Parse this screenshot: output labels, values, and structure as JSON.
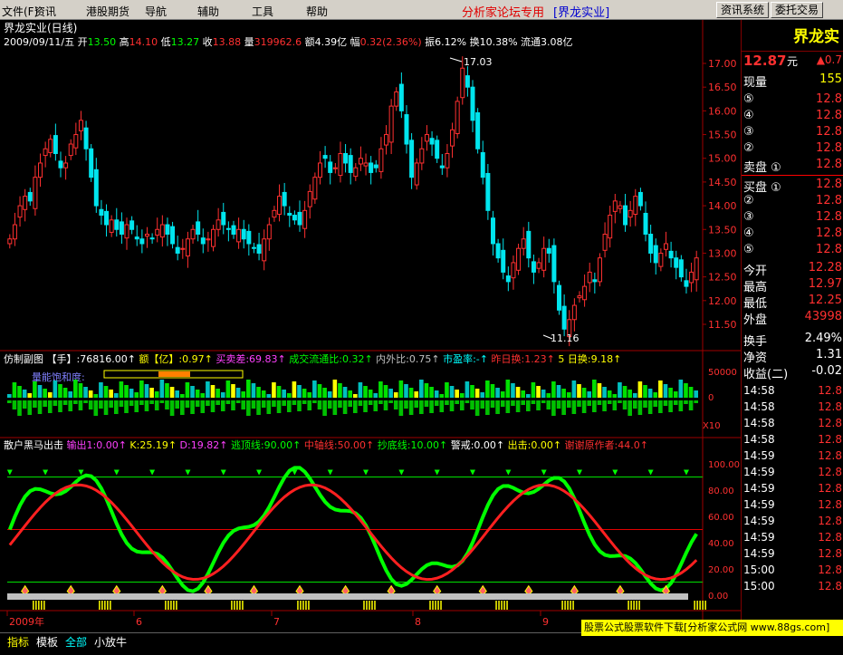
{
  "menu": {
    "items": [
      "文件(F)",
      "资讯",
      "港股期货",
      "导航",
      "辅助",
      "工具",
      "帮助"
    ],
    "forum_label": "分析家论坛专用",
    "forum_stock": "[界龙实业]",
    "btn_info": "资讯系统",
    "btn_trade": "委托交易"
  },
  "main": {
    "title": "界龙实业(日线)",
    "date": "2009/09/11/五",
    "quote": [
      {
        "l": "开",
        "v": "13.50",
        "c": "#00ff00"
      },
      {
        "l": "高",
        "v": "14.10",
        "c": "#ff3030"
      },
      {
        "l": "低",
        "v": "13.27",
        "c": "#00ff00"
      },
      {
        "l": "收",
        "v": "13.88",
        "c": "#ff3030"
      },
      {
        "l": "量",
        "v": "319962.6",
        "c": "#ff3030"
      },
      {
        "l": "额",
        "v": "4.39亿",
        "c": "#ffffff"
      },
      {
        "l": "幅",
        "v": "0.32(2.36%)",
        "c": "#ff3030"
      },
      {
        "l": "振",
        "v": "6.12%",
        "c": "#ffffff"
      },
      {
        "l": "换",
        "v": "10.38%",
        "c": "#ffffff"
      },
      {
        "l": "流通",
        "v": "3.08亿",
        "c": "#ffffff"
      }
    ],
    "y_ticks": [
      "17.00",
      "16.50",
      "16.00",
      "15.50",
      "15.00",
      "14.50",
      "14.00",
      "13.50",
      "13.00",
      "12.50",
      "12.00",
      "11.50"
    ],
    "high_label": "17.03",
    "low_label": "11.16"
  },
  "sub1": {
    "name": "仿制副图",
    "seg": [
      {
        "t": "【手】:76816.00",
        "c": "#ffffff"
      },
      {
        "t": "额【亿】:0.97",
        "c": "#ffff00"
      },
      {
        "t": "买卖差:69.83",
        "c": "#ff40ff"
      },
      {
        "t": "成交流通比:0.32",
        "c": "#00ff00"
      },
      {
        "t": "内外比:0.75",
        "c": "#c0c0c0"
      },
      {
        "t": "市盈率:-",
        "c": "#00ffff"
      },
      {
        "t": "昨日换:1.23",
        "c": "#ff3030"
      },
      {
        "t": "5 日换:9.18",
        "c": "#ffff00"
      }
    ],
    "vol_label": "量能饱和度:",
    "y_ticks": [
      "50000",
      "0"
    ],
    "scale_label": "X10"
  },
  "sub2": {
    "name": "散户黑马出击",
    "seg": [
      {
        "t": "输出1:0.00",
        "c": "#ff40ff"
      },
      {
        "t": "K:25.19",
        "c": "#ffff00"
      },
      {
        "t": "D:19.82",
        "c": "#ff40ff"
      },
      {
        "t": "逃顶线:90.00",
        "c": "#00ff00"
      },
      {
        "t": "中轴线:50.00",
        "c": "#ff3030"
      },
      {
        "t": "抄底线:10.00",
        "c": "#00ff00"
      },
      {
        "t": "警戒:0.00",
        "c": "#ffffff"
      },
      {
        "t": "出击:0.00",
        "c": "#ffff00"
      },
      {
        "t": "谢谢原作者:44.0",
        "c": "#ff3030"
      }
    ],
    "y_ticks": [
      "100.00",
      "80.00",
      "60.00",
      "40.00",
      "20.00",
      "0.00"
    ]
  },
  "x_labels": [
    "2009年",
    "6",
    "7",
    "8",
    "9"
  ],
  "right_panel": {
    "name": "界龙实",
    "price": "12.87",
    "unit": "元",
    "change": "0.7",
    "volume_label": "现量",
    "volume": "155",
    "sell": [
      {
        "l": "⑤",
        "p": "12.8"
      },
      {
        "l": "④",
        "p": "12.8"
      },
      {
        "l": "③",
        "p": "12.8"
      },
      {
        "l": "②",
        "p": "12.8"
      },
      {
        "l": "卖盘 ①",
        "p": "12.8"
      }
    ],
    "buy": [
      {
        "l": "买盘 ①",
        "p": "12.8"
      },
      {
        "l": "②",
        "p": "12.8"
      },
      {
        "l": "③",
        "p": "12.8"
      },
      {
        "l": "④",
        "p": "12.8"
      },
      {
        "l": "⑤",
        "p": "12.8"
      }
    ],
    "stats": [
      {
        "l": "今开",
        "v": "12.28",
        "c": "#ff3030"
      },
      {
        "l": "最高",
        "v": "12.97",
        "c": "#ff3030"
      },
      {
        "l": "最低",
        "v": "12.25",
        "c": "#ff3030"
      },
      {
        "l": "外盘",
        "v": "43998",
        "c": "#ff3030"
      }
    ],
    "stats2": [
      {
        "l": "换手",
        "v": "2.49%",
        "c": "#ffffff"
      },
      {
        "l": "净资",
        "v": "1.31",
        "c": "#ffffff"
      },
      {
        "l": "收益(二)",
        "v": "-0.02",
        "c": "#ffffff"
      }
    ],
    "trade_times": [
      "14:58",
      "14:58",
      "14:58",
      "14:58",
      "14:59",
      "14:59",
      "14:59",
      "14:59",
      "14:59",
      "14:59",
      "14:59",
      "15:00",
      "15:00"
    ],
    "trade_price": "12.8"
  },
  "bottom": {
    "tabs": [
      "指标",
      "模板",
      "全部",
      "小放牛"
    ],
    "ad": "股票公式股票软件下载[分析家公式网 www.88gs.com]"
  }
}
